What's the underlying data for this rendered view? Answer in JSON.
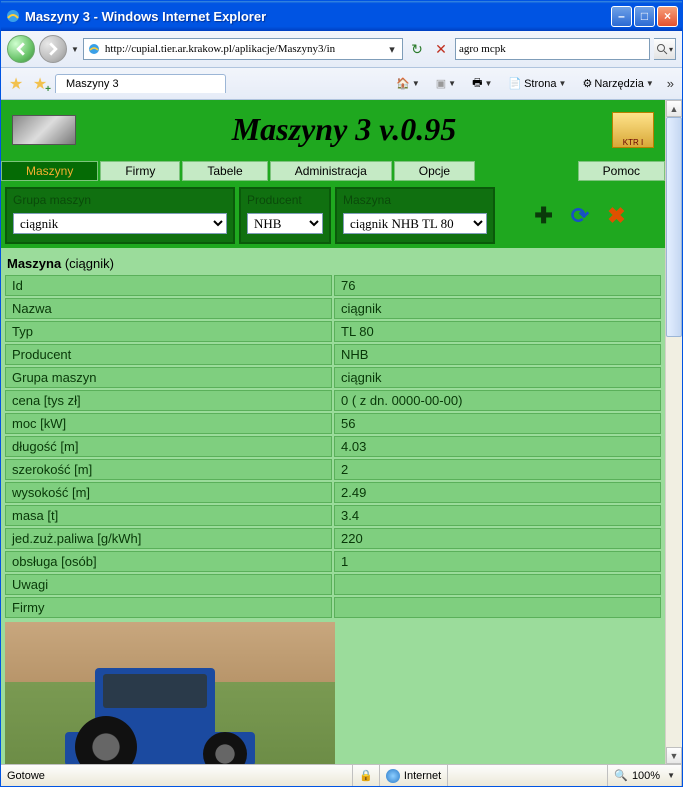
{
  "window": {
    "title": "Maszyny 3 - Windows Internet Explorer"
  },
  "nav": {
    "url": "http://cupial.tier.ar.krakow.pl/aplikacje/Maszyny3/in",
    "search_value": "agro mcpk"
  },
  "tab": {
    "title": "Maszyny 3"
  },
  "toolbar": {
    "page_label": "Strona",
    "tools_label": "Narzędzia"
  },
  "app": {
    "title": "Maszyny 3 v.0.95",
    "badge_text": "KTR I",
    "menu": {
      "maszyny": "Maszyny",
      "firmy": "Firmy",
      "tabele": "Tabele",
      "admin": "Administracja",
      "opcje": "Opcje",
      "pomoc": "Pomoc"
    },
    "filters": {
      "grupa_label": "Grupa maszyn",
      "grupa_value": "ciągnik",
      "producent_label": "Producent",
      "producent_value": "NHB",
      "maszyna_label": "Maszyna",
      "maszyna_value": "ciągnik NHB TL 80"
    },
    "detail_heading_bold": "Maszyna",
    "detail_heading_paren": "(ciągnik)",
    "rows": [
      {
        "k": "Id",
        "v": "76"
      },
      {
        "k": "Nazwa",
        "v": "ciągnik"
      },
      {
        "k": "Typ",
        "v": "TL 80"
      },
      {
        "k": "Producent",
        "v": "NHB"
      },
      {
        "k": "Grupa maszyn",
        "v": "ciągnik"
      },
      {
        "k": "cena [tys zł]",
        "v": "0 ( z dn. 0000-00-00)"
      },
      {
        "k": "moc [kW]",
        "v": "56"
      },
      {
        "k": "długość [m]",
        "v": "4.03"
      },
      {
        "k": "szerokość [m]",
        "v": "2"
      },
      {
        "k": "wysokość [m]",
        "v": "2.49"
      },
      {
        "k": "masa [t]",
        "v": "3.4"
      },
      {
        "k": "jed.zuż.paliwa [g/kWh]",
        "v": "220"
      },
      {
        "k": "obsługa [osób]",
        "v": "1"
      },
      {
        "k": "Uwagi",
        "v": ""
      },
      {
        "k": "Firmy",
        "v": ""
      }
    ]
  },
  "status": {
    "left": "Gotowe",
    "zone": "Internet",
    "zoom": "100%"
  }
}
